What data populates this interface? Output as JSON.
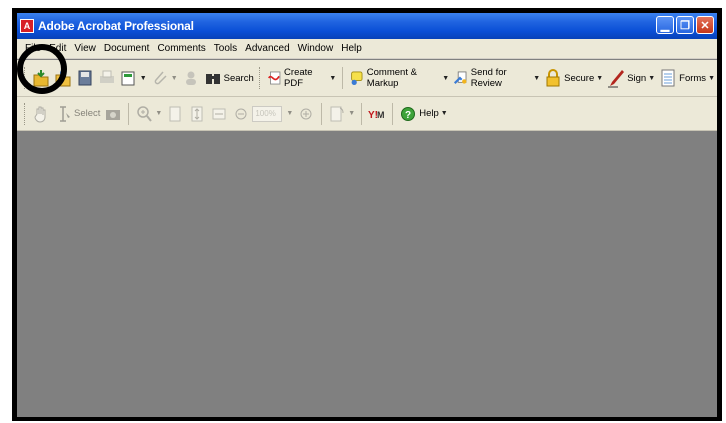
{
  "window": {
    "title": "Adobe Acrobat Professional",
    "icon": "acrobat-logo-icon",
    "controls": {
      "minimize": "minimize-icon",
      "restore": "restore-icon",
      "close": "close-icon"
    }
  },
  "menubar": {
    "items": [
      "File",
      "Edit",
      "View",
      "Document",
      "Comments",
      "Tools",
      "Advanced",
      "Window",
      "Help"
    ]
  },
  "toolbar1": {
    "search_label": "Search",
    "create_pdf_label": "Create PDF",
    "comment_markup_label": "Comment & Markup",
    "send_review_label": "Send for Review",
    "secure_label": "Secure",
    "sign_label": "Sign",
    "forms_label": "Forms"
  },
  "toolbar2": {
    "select_label": "Select",
    "zoom_value": "100%",
    "help_label": "Help"
  },
  "annotation": {
    "target": "File menu",
    "color": "#000000"
  },
  "colors": {
    "titlebar": "#0a4fd6",
    "chrome": "#ece9d8",
    "workspace": "#808080"
  }
}
